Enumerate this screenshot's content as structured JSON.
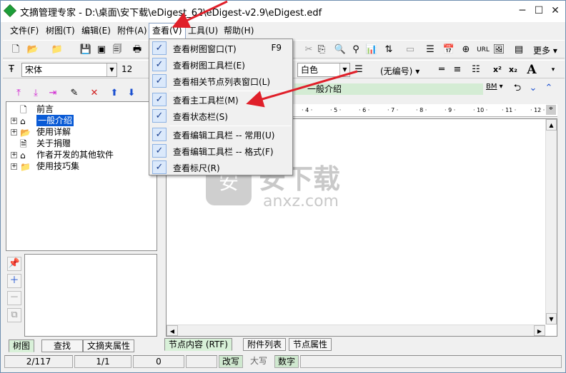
{
  "window": {
    "title": "文摘管理专家 - D:\\桌面\\安下载\\eDigest_62\\eDigest-v2.9\\eDigest.edf",
    "minimize": "─",
    "maximize": "☐",
    "close": "✕"
  },
  "menubar": {
    "items": [
      "文件(F)",
      "树图(T)",
      "编辑(E)",
      "附件(A)",
      "查看(V)",
      "工具(U)",
      "帮助(H)"
    ]
  },
  "format_toolbar": {
    "font": "宋体",
    "size": "12",
    "color": "白色",
    "numbering": "(无编号)",
    "more_label": "更多",
    "sup": "x²",
    "sub": "x₂",
    "bigA": "A"
  },
  "view_menu": {
    "items": [
      {
        "label": "查看树图窗口(T)",
        "shortcut": "F9",
        "checked": true
      },
      {
        "label": "查看树图工具栏(E)",
        "shortcut": "",
        "checked": true
      },
      {
        "label": "查看相关节点列表窗口(L)",
        "shortcut": "",
        "checked": true
      },
      {
        "label": "查看主工具栏(M)",
        "shortcut": "",
        "checked": true
      },
      {
        "label": "查看状态栏(S)",
        "shortcut": "",
        "checked": true
      },
      {
        "label": "查看编辑工具栏 -- 常用(U)",
        "shortcut": "",
        "checked": true
      },
      {
        "label": "查看编辑工具栏 -- 格式(F)",
        "shortcut": "",
        "checked": true
      },
      {
        "label": "查看标尺(R)",
        "shortcut": "",
        "checked": true
      }
    ]
  },
  "tree": {
    "nodes": [
      {
        "label": "前言",
        "icon": "page-icon",
        "expandable": false,
        "selected": false
      },
      {
        "label": "一般介绍",
        "icon": "home-icon",
        "expandable": true,
        "selected": true
      },
      {
        "label": "使用详解",
        "icon": "folder-open-icon",
        "expandable": true,
        "selected": false
      },
      {
        "label": "关于捐赠",
        "icon": "page-icon",
        "expandable": false,
        "selected": false
      },
      {
        "label": "作者开发的其他软件",
        "icon": "home-icon",
        "expandable": true,
        "selected": false
      },
      {
        "label": "使用技巧集",
        "icon": "folder-icon",
        "expandable": true,
        "selected": false
      }
    ]
  },
  "editor": {
    "node_title": "一般介绍",
    "bm_label": "BM",
    "ruler_ticks": [
      "4",
      "5",
      "6",
      "7",
      "8",
      "9",
      "10",
      "11",
      "12"
    ]
  },
  "left_tabs": [
    "树图",
    "查找",
    "文摘夹属性"
  ],
  "right_tabs": [
    "节点内容 (RTF)",
    "附件列表",
    "节点属性"
  ],
  "statusbar": {
    "position": "2/117",
    "page": "1/1",
    "count": "0",
    "modified": "改写",
    "caps": "大写",
    "num": "数字"
  },
  "watermark": {
    "text_cn": "安下载",
    "text_en": "anxz.com"
  },
  "colors": {
    "selection": "#0a5bd6",
    "check_bg": "#dbe9fb",
    "title_bar_green": "#d4ecd4",
    "arrow_red": "#e0202a"
  }
}
